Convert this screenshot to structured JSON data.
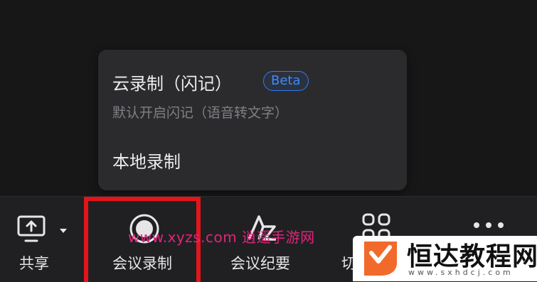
{
  "dropdown": {
    "cloud_title": "云录制（闪记）",
    "cloud_badge": "Beta",
    "cloud_subtitle": "默认开启闪记（语音转文字）",
    "local_title": "本地录制"
  },
  "toolbar": {
    "share_label": "共享",
    "record_label": "会议录制",
    "minutes_label": "会议纪要",
    "switch_label": "切",
    "more_icon": "more-icon"
  },
  "colors": {
    "badge_blue": "#2e7cf6",
    "highlight_red": "#e3141a",
    "watermark_pink": "#e0257a",
    "brand_orange": "#f26a2a"
  },
  "watermark": {
    "text": "www.xyzs.com 逍遥手游网",
    "brand_name": "恒达教程网",
    "brand_url": "www.sxhdcj.com"
  }
}
